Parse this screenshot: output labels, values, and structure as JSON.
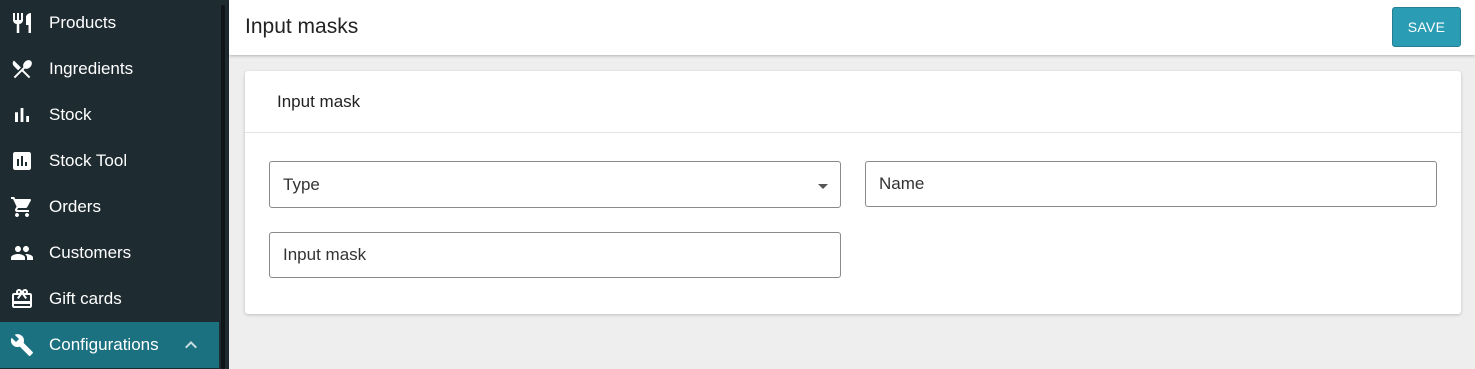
{
  "sidebar": {
    "items": [
      {
        "label": "Products",
        "icon": "fork-knife-icon"
      },
      {
        "label": "Ingredients",
        "icon": "spoon-knife-crossed-icon"
      },
      {
        "label": "Stock",
        "icon": "bar-chart-icon"
      },
      {
        "label": "Stock Tool",
        "icon": "chart-box-icon"
      },
      {
        "label": "Orders",
        "icon": "shopping-cart-icon"
      },
      {
        "label": "Customers",
        "icon": "people-icon"
      },
      {
        "label": "Gift cards",
        "icon": "gift-card-icon"
      },
      {
        "label": "Configurations",
        "icon": "wrench-icon",
        "active": true,
        "expanded": true
      }
    ]
  },
  "header": {
    "title": "Input masks",
    "save_label": "SAVE"
  },
  "card": {
    "title": "Input mask",
    "fields": {
      "type": {
        "placeholder": "Type",
        "value": ""
      },
      "name": {
        "placeholder": "Name",
        "value": ""
      },
      "input_mask": {
        "placeholder": "Input mask",
        "value": ""
      }
    }
  },
  "colors": {
    "sidebar_bg": "#1e2b30",
    "active_item": "#1b7180",
    "save_button": "#2a9db5",
    "page_bg": "#eeeeee"
  }
}
